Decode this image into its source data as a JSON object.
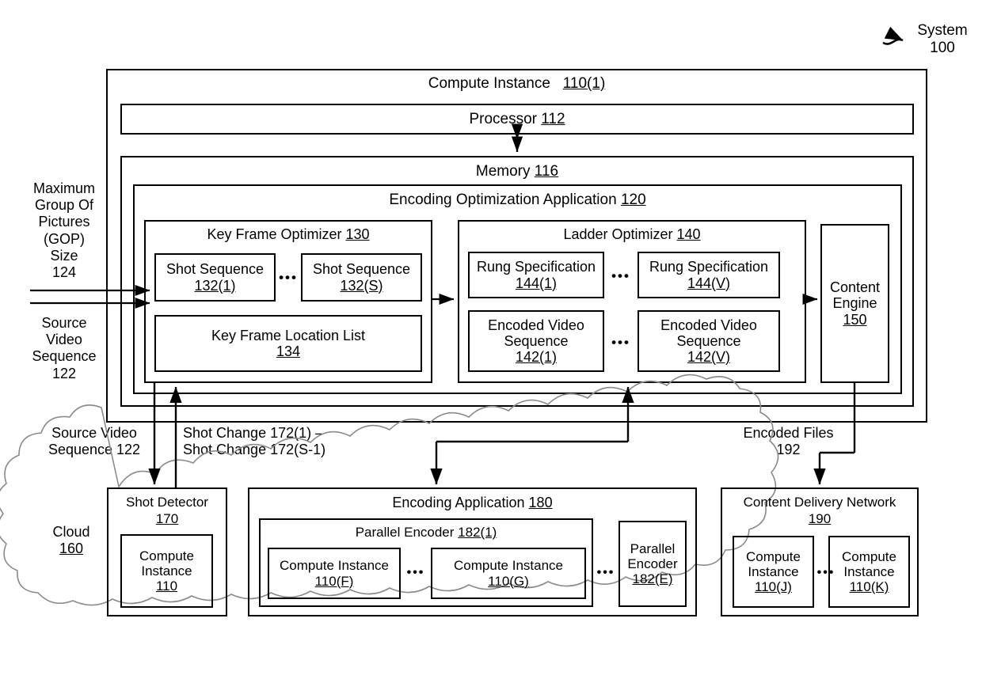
{
  "figure": {
    "system_label_line1": "System",
    "system_label_line2": "100"
  },
  "compute_instance": {
    "title": "Compute Instance",
    "ref": "110(1)",
    "processor": {
      "title": "Processor",
      "ref": "112"
    },
    "memory": {
      "title": "Memory",
      "ref": "116"
    }
  },
  "encoding_optimization_application": {
    "title": "Encoding Optimization Application",
    "ref": "120",
    "key_frame_optimizer": {
      "title": "Key Frame Optimizer",
      "ref": "130",
      "shot_sequences": [
        {
          "title": "Shot Sequence",
          "ref": "132(1)"
        },
        {
          "title": "Shot Sequence",
          "ref": "132(S)"
        }
      ],
      "ellipsis": "•••",
      "key_frame_location_list": {
        "title": "Key Frame Location List",
        "ref": "134"
      }
    },
    "ladder_optimizer": {
      "title": "Ladder Optimizer",
      "ref": "140",
      "rung_specifications": [
        {
          "title": "Rung Specification",
          "ref": "144(1)"
        },
        {
          "title": "Rung Specification",
          "ref": "144(V)"
        }
      ],
      "encoded_video_sequences": [
        {
          "title_line1": "Encoded Video",
          "title_line2": "Sequence",
          "ref": "142(1)"
        },
        {
          "title_line1": "Encoded Video",
          "title_line2": "Sequence",
          "ref": "142(V)"
        }
      ],
      "ellipsis": "•••"
    },
    "content_engine": {
      "title_line1": "Content",
      "title_line2": "Engine",
      "ref": "150"
    }
  },
  "inputs": {
    "max_gop_size": {
      "lines": [
        "Maximum",
        "Group Of",
        "Pictures",
        "(GOP)",
        "Size"
      ],
      "ref": "124"
    },
    "source_video_sequence": {
      "lines": [
        "Source",
        "Video",
        "Sequence"
      ],
      "ref": "122"
    }
  },
  "connector_labels": {
    "source_video_sequence_down": {
      "line1": "Source Video",
      "line2": "Sequence 122"
    },
    "shot_changes": {
      "line1": "Shot Change 172(1) –",
      "line2": "Shot Change 172(S-1)"
    },
    "encoded_files": {
      "line1": "Encoded Files",
      "line2": "192"
    }
  },
  "cloud": {
    "title": "Cloud",
    "ref": "160",
    "shot_detector": {
      "title": "Shot Detector",
      "ref": "170",
      "compute_instance": {
        "title_line1": "Compute",
        "title_line2": "Instance",
        "ref": "110"
      }
    },
    "encoding_application": {
      "title": "Encoding Application",
      "ref": "180",
      "parallel_encoder_first": {
        "title": "Parallel Encoder",
        "ref": "182(1)",
        "compute_instances": [
          {
            "title": "Compute Instance",
            "ref": "110(F)"
          },
          {
            "title": "Compute Instance",
            "ref": "110(G)"
          }
        ],
        "ellipsis": "•••"
      },
      "outer_ellipsis": "•••",
      "parallel_encoder_last": {
        "title_line1": "Parallel",
        "title_line2": "Encoder",
        "ref": "182(E)"
      }
    },
    "content_delivery_network": {
      "title": "Content Delivery Network",
      "ref": "190",
      "compute_instances": [
        {
          "title_line1": "Compute",
          "title_line2": "Instance",
          "ref": "110(J)"
        },
        {
          "title_line1": "Compute",
          "title_line2": "Instance",
          "ref": "110(K)"
        }
      ],
      "ellipsis": "•••"
    }
  },
  "style": {
    "ink": "#000000",
    "cloud_stroke": "#808080",
    "background": "#ffffff"
  }
}
